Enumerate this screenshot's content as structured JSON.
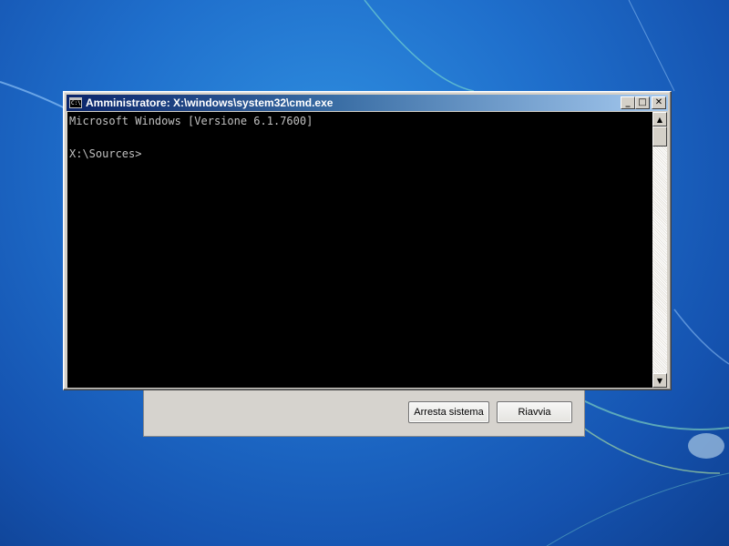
{
  "window": {
    "title": "Amministratore: X:\\windows\\system32\\cmd.exe",
    "icon": "console-icon",
    "icon_text": "C:\\"
  },
  "titlebar_buttons": {
    "minimize": "_",
    "maximize": "□",
    "close": "✕"
  },
  "console": {
    "lines": [
      "Microsoft Windows [Versione 6.1.7600]",
      "",
      "X:\\Sources>"
    ]
  },
  "dialog": {
    "shutdown_label": "Arresta sistema",
    "restart_label": "Riavvia"
  },
  "scrollbar": {
    "up_arrow": "▲",
    "down_arrow": "▼"
  },
  "colors": {
    "desktop": "#1f6fcc",
    "console_bg": "#000000",
    "console_text": "#c0c0c0",
    "titlebar": "#0a246a"
  }
}
